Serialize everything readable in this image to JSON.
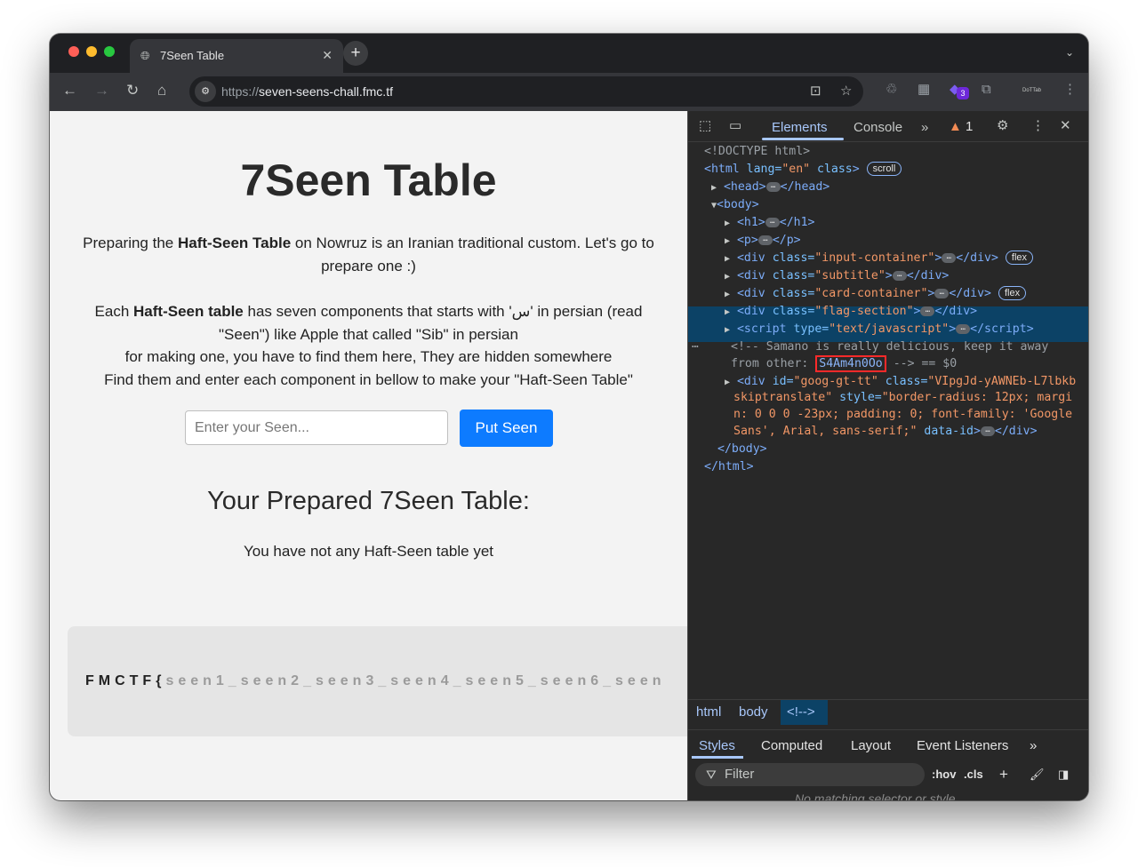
{
  "browser": {
    "tab_title": "7Seen Table",
    "new_tab": "+",
    "url_scheme": "https://",
    "url_host": "seven-seens-chall.fmc.tf",
    "extension_badge": "3",
    "extension_label": "DoTTab"
  },
  "page": {
    "title": "7Seen Table",
    "intro_pre": "Preparing the ",
    "intro_bold": "Haft-Seen Table",
    "intro_post": " on Nowruz is an Iranian traditional custom. Let's go to prepare one :)",
    "line1_pre": "Each ",
    "line1_bold": "Haft-Seen table",
    "line1_post": " has seven components that starts with 'س' in persian (read \"Seen\") like Apple that called \"Sib\" in persian",
    "line2": "for making one, you have to find them here, They are hidden somewhere",
    "line3": "Find them and enter each component in bellow to make your \"Haft-Seen Table\"",
    "input_placeholder": "Enter your Seen...",
    "button": "Put Seen",
    "subtitle": "Your Prepared 7Seen Table:",
    "empty_text": "You have not any Haft-Seen table yet",
    "flag_prefix": "FMCTF{",
    "flag_rest": "seen1_seen2_seen3_seen4_seen5_seen6_seen"
  },
  "devtools": {
    "tabs": [
      "Elements",
      "Console"
    ],
    "warning_count": "1",
    "lines": {
      "doctype": "<!DOCTYPE html>",
      "html_open_tag": "<html",
      "html_attr": " lang=",
      "html_lang": "\"en\"",
      "html_class_attr": " class",
      "html_close": ">",
      "scroll_pill": "scroll",
      "head": "<head>",
      "head_close": "</head>",
      "body": "<body>",
      "h1": "<h1>",
      "h1_close": "</h1>",
      "p": "<p>",
      "p_close": "</p>",
      "div_input": "input-container",
      "div_subtitle": "subtitle",
      "div_card": "card-container",
      "div_flag": "flag-section",
      "script_type": "text/javascript",
      "flex_pill": "flex",
      "comment_1": "<!-- Samano is really delicious, keep it away",
      "comment_2_pre": "from other: ",
      "comment_secret": "S4Am4n0Oo",
      "comment_2_post": " --> == $0",
      "goog_1_id": "\"goog-gt-tt\"",
      "goog_1_class": "\"VIpgJd-yAWNEb-L7lbkb",
      "goog_2": "skiptranslate\"",
      "goog_2_style": " style=",
      "goog_2_val": "\"border-radius: 12px; margi",
      "goog_3": "n: 0 0 0 -23px; padding: 0; font-family: 'Google",
      "goog_4": "Sans', Arial, sans-serif;\"",
      "goog_4_attr": " data-id",
      "body_close": "</body>",
      "html_close_tag": "</html>"
    },
    "breadcrumb": [
      "html",
      "body",
      "<!-->"
    ],
    "style_tabs": [
      "Styles",
      "Computed",
      "Layout",
      "Event Listeners"
    ],
    "filter_placeholder": "Filter",
    "hov": ":hov",
    "cls": ".cls",
    "no_match": "No matching selector or style"
  }
}
